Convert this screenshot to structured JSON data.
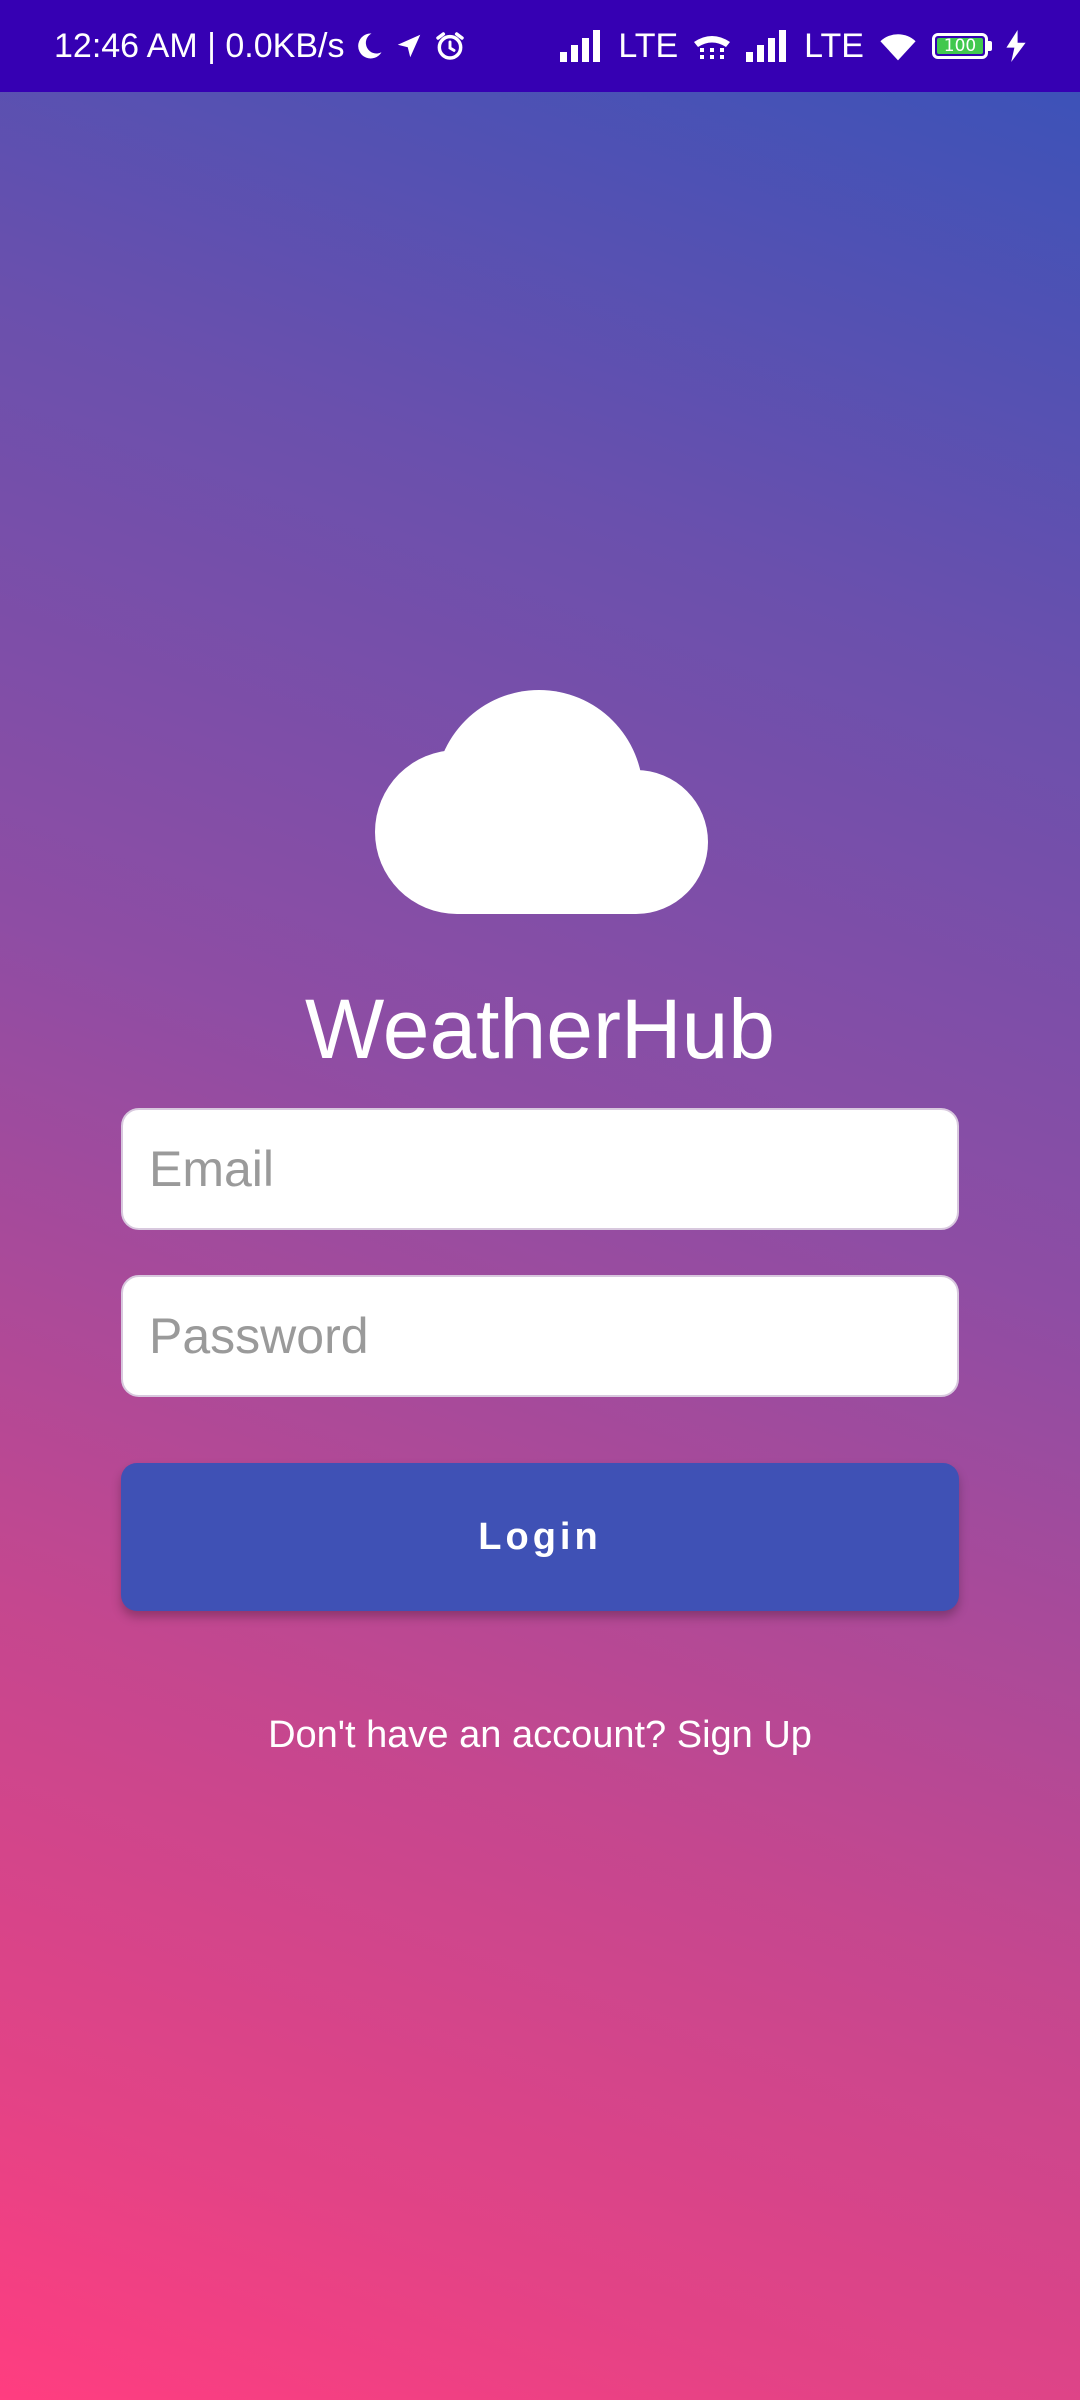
{
  "status_bar": {
    "time_network": "12:46 AM | 0.0KB/s",
    "lte_1": "LTE",
    "lte_2": "LTE",
    "battery_level": "100",
    "icons": [
      "moon-icon",
      "location-arrow-icon",
      "alarm-icon",
      "signal-icon",
      "volte-icon",
      "signal-icon",
      "wifi-icon",
      "battery-icon",
      "charging-icon"
    ]
  },
  "app": {
    "title": "WeatherHub",
    "logo_icon": "cloud-icon"
  },
  "form": {
    "email_placeholder": "Email",
    "password_placeholder": "Password",
    "login_label": "Login",
    "signup_text": "Don't have an account? Sign Up"
  },
  "colors": {
    "status_bar": "#3600b3",
    "gradient_top": "#3d52b8",
    "gradient_bottom": "#ff3d80",
    "button": "#3f51b5",
    "battery": "#41c84e"
  }
}
